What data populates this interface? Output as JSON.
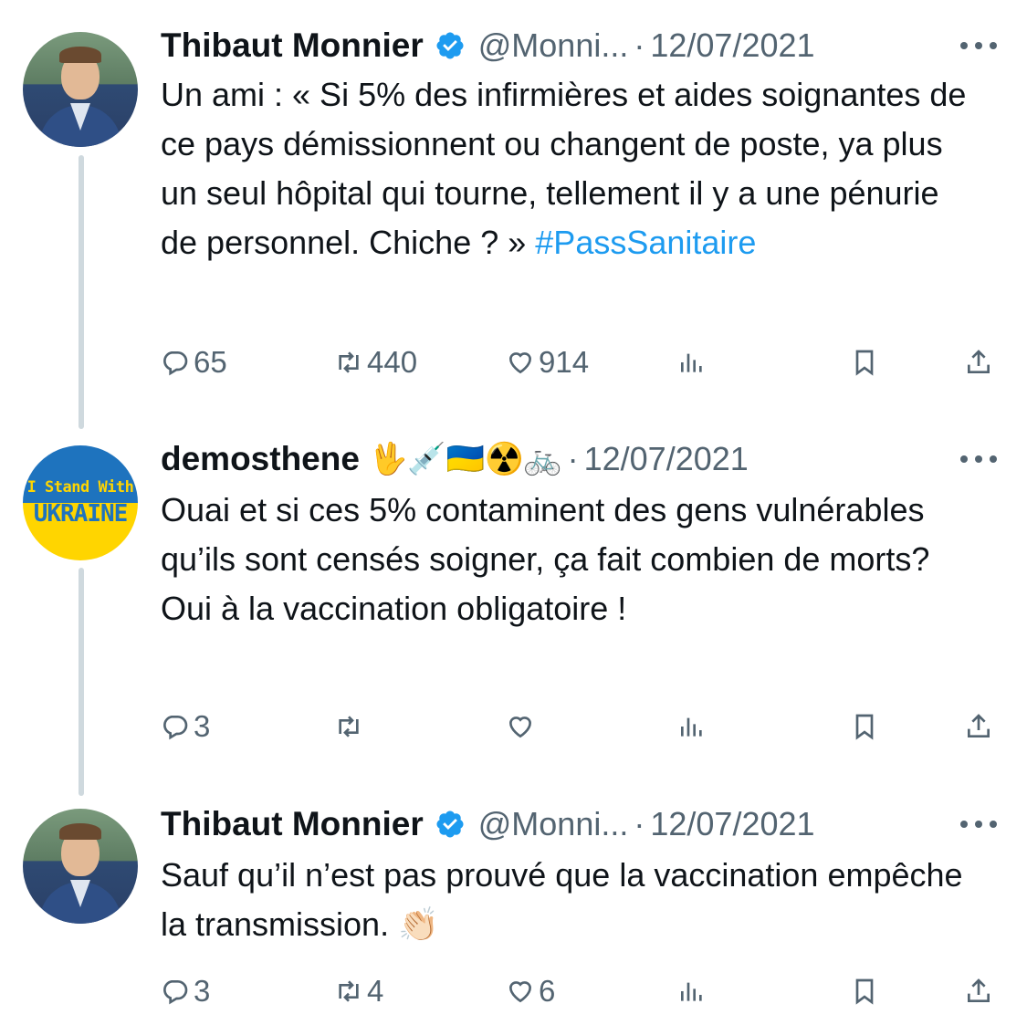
{
  "tweets": [
    {
      "author": "Thibaut Monnier",
      "verified": true,
      "handle": "@Monni...",
      "dot": "·",
      "date": "12/07/2021",
      "avatar": "person-avatar",
      "text_before": "Un ami : « Si 5% des infirmières et aides soignantes de ce pays démissionnent ou changent de poste, ya plus un seul hôpital qui tourne, tellement il y a une pénurie de personnel. Chiche ? » ",
      "hashtag": "#PassSanitaire",
      "replies": "65",
      "retweets": "440",
      "likes": "914"
    },
    {
      "author": "demosthene",
      "verified": false,
      "name_emojis": "🖖💉🇺🇦☢️🚲",
      "dot": "·",
      "date": "12/07/2021",
      "avatar": "ukraine-avatar",
      "avatar_line1": "I Stand With",
      "avatar_line2": "UKRAINE",
      "text": "Ouai et si ces 5% contaminent des gens vulnérables qu’ils sont censés soigner, ça fait combien de morts? Oui à la vaccination obligatoire !",
      "replies": "3",
      "retweets": "",
      "likes": ""
    },
    {
      "author": "Thibaut Monnier",
      "verified": true,
      "handle": "@Monni...",
      "dot": "·",
      "date": "12/07/2021",
      "avatar": "person-avatar",
      "text": "Sauf qu’il n’est pas prouvé que la vaccination empêche la transmission. 👏🏻",
      "replies": "3",
      "retweets": "4",
      "likes": "6"
    }
  ],
  "icons": {
    "reply": "reply-icon",
    "retweet": "retweet-icon",
    "like": "heart-icon",
    "views": "views-chart-icon",
    "bookmark": "bookmark-icon",
    "share": "share-icon",
    "more": "more-dots-icon",
    "verified": "verified-badge-icon"
  },
  "colors": {
    "text": "#0f1419",
    "muted": "#536471",
    "link": "#1d9bf0",
    "verified": "#1d9bf0",
    "thread_line": "#cfd9de"
  }
}
